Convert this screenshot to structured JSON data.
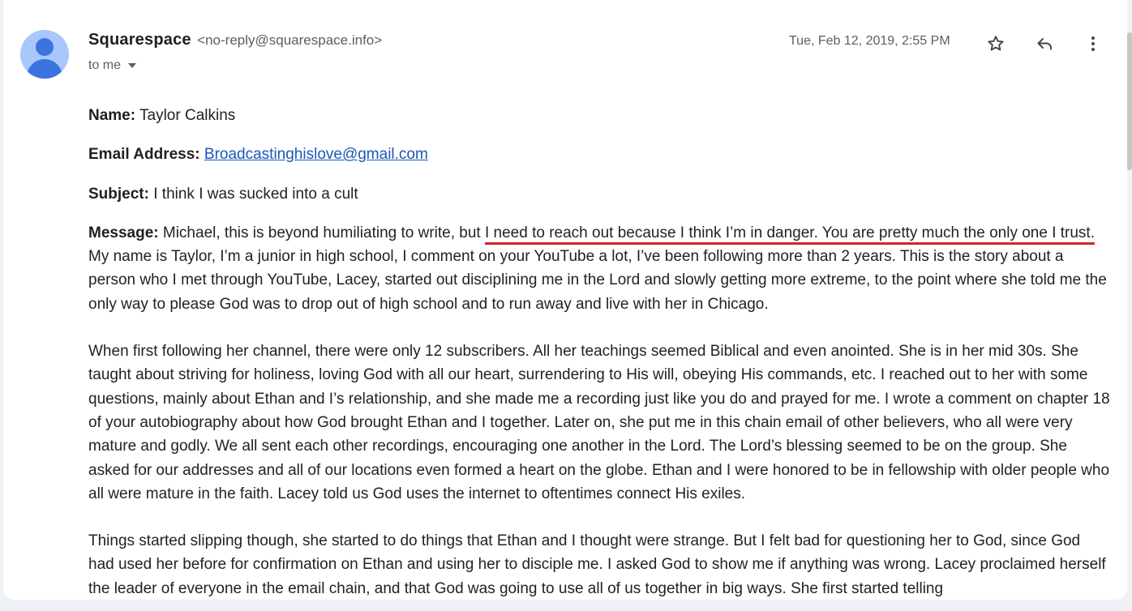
{
  "header": {
    "sender_name": "Squarespace",
    "sender_email": "<no-reply@squarespace.info>",
    "recipient": "to me",
    "timestamp": "Tue, Feb 12, 2019, 2:55 PM",
    "icons": [
      "star-icon",
      "reply-icon",
      "more-vert-icon"
    ]
  },
  "fields": {
    "name_label": "Name:",
    "name_value": " Taylor Calkins",
    "email_label": "Email Address:",
    "email_value": "Broadcastinghislove@gmail.com",
    "subject_label": "Subject:",
    "subject_value": " I think I was sucked into a cult",
    "message_label": "Message:"
  },
  "message": {
    "p1_start": " Michael, this is beyond humiliating to write, but ",
    "p1_underlined": "I need to reach out because I think I’m in danger. You are pretty much the only one I trust.",
    "p1_rest": " My name is Taylor, I’m a junior in high school, I comment on your YouTube a lot, I’ve been following more than 2 years. This is the story about a person who I met through YouTube, Lacey, started out disciplining me in the Lord and slowly getting more extreme, to the point where she told me the only way to please God was to drop out of high school and to run away and live with her in Chicago.",
    "p2": "When first following her channel, there were only 12 subscribers. All her teachings seemed Biblical and even anointed. She is in her mid 30s. She taught about striving for holiness, loving God with all our heart, surrendering to His will, obeying His commands, etc. I reached out to her with some questions, mainly about Ethan and I’s relationship, and she made me a recording just like you do and prayed for me. I wrote a comment on chapter 18 of your autobiography about how God brought Ethan and I together. Later on, she put me in this chain email of other believers, who all were very mature and godly. We all sent each other recordings, encouraging one another in the Lord. The Lord’s blessing seemed to be on the group. She asked for our addresses and all of our locations even formed a heart on the globe. Ethan and I were honored to be in fellowship with older people who all were mature in the faith. Lacey told us God uses the internet to oftentimes connect His exiles.",
    "p3": "Things started slipping though, she started to do things that Ethan and I thought were strange. But I felt bad for questioning her to God, since God had used her before for confirmation on Ethan and using her to disciple me. I asked God to show me if anything was wrong. Lacey proclaimed herself the leader of everyone in the email chain, and that God was going to use all of us together in big ways. She first started telling"
  },
  "colors": {
    "background": "#eef2f7",
    "link": "#1a57b8",
    "highlight_underline": "#d4212d",
    "avatar_bg": "#a8c7fa",
    "avatar_fg": "#3b74e0"
  }
}
